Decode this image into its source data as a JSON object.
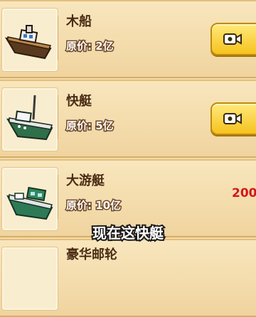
{
  "ships": [
    {
      "name": "木船",
      "price_label": "原价:",
      "price_value": "2亿",
      "icon": "wooden-boat-icon",
      "button_icon": "video-camera-icon"
    },
    {
      "name": "快艇",
      "price_label": "原价:",
      "price_value": "5亿",
      "icon": "speedboat-icon",
      "button_icon": "video-camera-icon"
    },
    {
      "name": "大游艇",
      "price_label": "原价:",
      "price_value": "10亿",
      "icon": "yacht-icon",
      "sale_price": "200"
    }
  ],
  "peek_row": {
    "name": "豪华邮轮"
  },
  "caption": "现在这快艇",
  "colors": {
    "background": "#f3dba9",
    "button": "#f6c21e",
    "sale_price": "#d3161b",
    "name": "#4a2c14"
  }
}
